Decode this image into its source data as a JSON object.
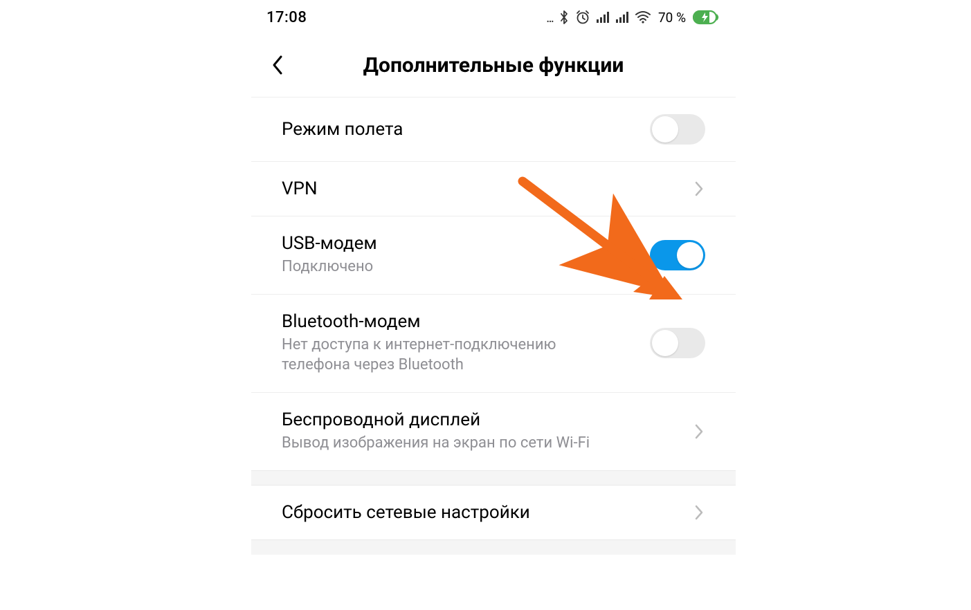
{
  "status_bar": {
    "time": "17:08",
    "battery_percent": "70 %",
    "icons": {
      "bluetooth": "bluetooth-icon",
      "alarm": "alarm-icon",
      "signal1": "signal-icon",
      "signal2": "signal-icon",
      "wifi": "wifi-icon",
      "battery": "battery-charging-icon"
    }
  },
  "header": {
    "title": "Дополнительные функции"
  },
  "rows": [
    {
      "id": "airplane-mode",
      "title": "Режим полета",
      "subtitle": "",
      "type": "toggle",
      "state": "off"
    },
    {
      "id": "vpn",
      "title": "VPN",
      "subtitle": "",
      "type": "nav"
    },
    {
      "id": "usb-modem",
      "title": "USB-модем",
      "subtitle": "Подключено",
      "type": "toggle",
      "state": "on"
    },
    {
      "id": "bluetooth-modem",
      "title": "Bluetooth-модем",
      "subtitle": "Нет доступа к интернет-подключению телефона через Bluetooth",
      "type": "toggle",
      "state": "off"
    },
    {
      "id": "wireless-display",
      "title": "Беспроводной дисплей",
      "subtitle": "Вывод изображения на экран по сети Wi-Fi",
      "type": "nav"
    },
    {
      "id": "reset-network",
      "title": "Сбросить сетевые настройки",
      "subtitle": "",
      "type": "nav"
    }
  ],
  "colors": {
    "toggle_on": "#0a97ea",
    "toggle_off": "#e9e9e9",
    "annotation_arrow": "#f26a1b"
  }
}
